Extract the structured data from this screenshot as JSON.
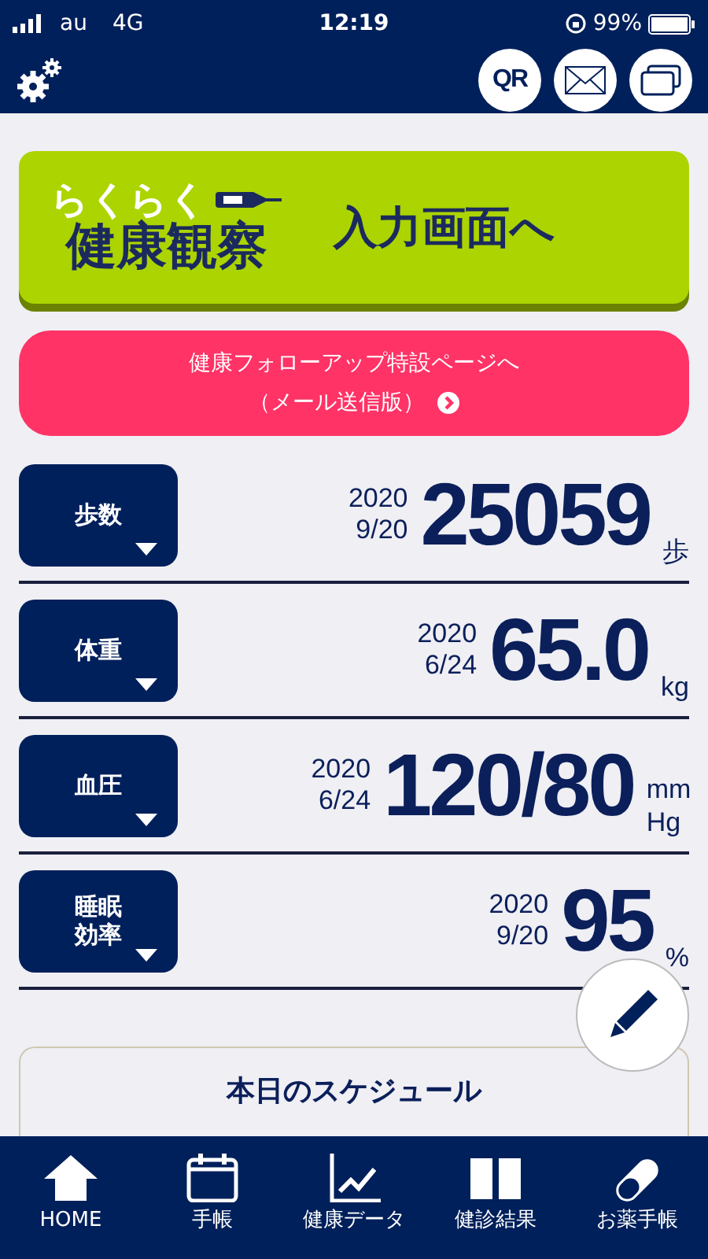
{
  "status_bar": {
    "carrier": "au",
    "network": "4G",
    "time": "12:19",
    "battery": "99%"
  },
  "header": {
    "qr_label": "QR"
  },
  "banner": {
    "logo_top": "らくらく",
    "logo_main": "健康観察",
    "action": "入力画面へ"
  },
  "followup": {
    "line1": "健康フォローアップ特設ページへ",
    "line2": "（メール送信版）"
  },
  "metrics": [
    {
      "label": "歩数",
      "year": "2020",
      "date": "9/20",
      "value": "25059",
      "unit": "歩"
    },
    {
      "label": "体重",
      "year": "2020",
      "date": "6/24",
      "value": "65.0",
      "unit": "kg"
    },
    {
      "label": "血圧",
      "year": "2020",
      "date": "6/24",
      "value": "120/80",
      "unit": "mm Hg"
    },
    {
      "label": "睡眠効率",
      "year": "2020",
      "date": "9/20",
      "value": "95",
      "unit": "%"
    }
  ],
  "schedule": {
    "title": "本日のスケジュール"
  },
  "bottom_nav": [
    {
      "label": "HOME",
      "kind": "home"
    },
    {
      "label": "手帳",
      "kind": "calendar"
    },
    {
      "label": "健康データ",
      "kind": "chart"
    },
    {
      "label": "健診結果",
      "kind": "book"
    },
    {
      "label": "お薬手帳",
      "kind": "pill"
    }
  ]
}
